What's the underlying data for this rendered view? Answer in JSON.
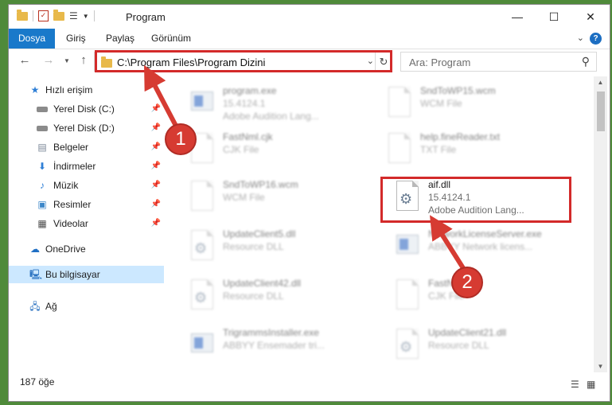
{
  "window": {
    "title": "Program"
  },
  "ribbon": {
    "file_tab": "Dosya",
    "tabs": [
      "Giriş",
      "Paylaş",
      "Görünüm"
    ]
  },
  "address": {
    "path": "C:\\Program Files\\Program Dizini",
    "search_placeholder": "Ara: Program"
  },
  "sidebar": {
    "quick_access": "Hızlı erişim",
    "items": [
      "Yerel Disk (C:)",
      "Yerel Disk (D:)",
      "Belgeler",
      "İndirmeler",
      "Müzik",
      "Resimler",
      "Videolar"
    ],
    "onedrive": "OneDrive",
    "this_pc": "Bu bilgisayar",
    "network": "Ağ"
  },
  "files": [
    {
      "name": "program.exe",
      "line2": "15.4124.1",
      "line3": "Adobe Audition Lang..."
    },
    {
      "name": "SndToWP15.wcm",
      "line2": "WCM File"
    },
    {
      "name": "FastNml.cjk",
      "line2": "CJK File"
    },
    {
      "name": "help.fineReader.txt",
      "line2": "TXT File"
    },
    {
      "name": "SndToWP16.wcm",
      "line2": "WCM File"
    },
    {
      "name": "aif.dll",
      "line2": "15.4124.1",
      "line3": "Adobe Audition Lang..."
    },
    {
      "name": "UpdateClient5.dll",
      "line2": "Resource DLL"
    },
    {
      "name": "NetworkLicenseServer.exe",
      "line2": "ABBYY Network licens..."
    },
    {
      "name": "UpdateClient42.dll",
      "line2": "Resource DLL"
    },
    {
      "name": "FastNml.cjk",
      "line2": "CJK File"
    },
    {
      "name": "TrigrammsInstaller.exe",
      "line2": "ABBYY Ensemader tri..."
    },
    {
      "name": "UpdateClient21.dll",
      "line2": "Resource DLL"
    }
  ],
  "status": {
    "count": "187 öğe"
  },
  "annotations": {
    "step1": "1",
    "step2": "2"
  },
  "colors": {
    "accent": "#1979ca",
    "annotation": "#d63b32",
    "selected": "#cce8ff"
  }
}
